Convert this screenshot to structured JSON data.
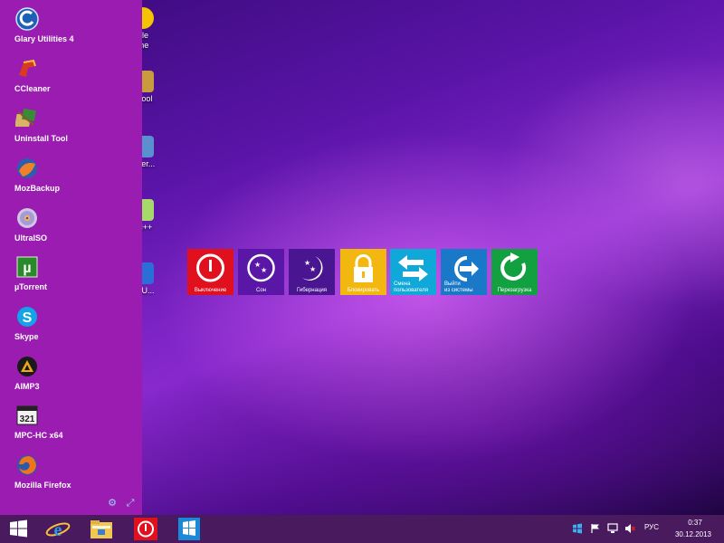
{
  "desktop_icons": [
    {
      "label": "gle\nme",
      "icon": "chrome-icon",
      "color": "#f5c400"
    },
    {
      "label": "l Tool",
      "icon": "uninstall-tool-icon",
      "color": "#c89b3c"
    },
    {
      "label": "wner...",
      "icon": "app-icon",
      "color": "#5a8fd0"
    },
    {
      "label": "ad++",
      "icon": "notepad-plus-icon",
      "color": "#a6d86a"
    },
    {
      "label": "_AU...",
      "icon": "app-icon",
      "color": "#2a6fd8"
    }
  ],
  "sidebar": {
    "items": [
      {
        "label": "Glary Utilities 4",
        "icon": "glary-utilities-icon"
      },
      {
        "label": "CCleaner",
        "icon": "ccleaner-icon"
      },
      {
        "label": "Uninstall Tool",
        "icon": "uninstall-tool-icon"
      },
      {
        "label": "MozBackup",
        "icon": "mozbackup-icon"
      },
      {
        "label": "UltraISO",
        "icon": "ultraiso-icon"
      },
      {
        "label": "µTorrent",
        "icon": "utorrent-icon"
      },
      {
        "label": "Skype",
        "icon": "skype-icon"
      },
      {
        "label": "AIMP3",
        "icon": "aimp-icon"
      },
      {
        "label": "MPC-HC x64",
        "icon": "mpc-hc-icon"
      },
      {
        "label": "Mozilla Firefox",
        "icon": "firefox-icon"
      }
    ],
    "color": "#9a1cb0"
  },
  "power_tiles": [
    {
      "label": "Выключение",
      "icon": "power-icon",
      "color": "#e0101e"
    },
    {
      "label": "Сон",
      "icon": "sleep-moon-icon",
      "color": "#5a16a6"
    },
    {
      "label": "Гибернация",
      "icon": "hibernate-moon-icon",
      "color": "#4a1590"
    },
    {
      "label": "Блокировать",
      "icon": "lock-icon",
      "color": "#f2b810"
    },
    {
      "label": "Смена\nпользователя",
      "icon": "switch-user-icon",
      "color": "#10a8d8"
    },
    {
      "label": "Выйти\nиз системы",
      "icon": "logoff-icon",
      "color": "#1a78c8"
    },
    {
      "label": "Перезагрузка",
      "icon": "restart-icon",
      "color": "#12a040"
    }
  ],
  "taskbar": {
    "buttons": [
      "start-button",
      "internet-explorer-button",
      "file-explorer-button",
      "power-app-button",
      "metro-app-button"
    ],
    "tray": {
      "language": "РУС",
      "time": "0:37",
      "date": "30.12.2013"
    }
  }
}
